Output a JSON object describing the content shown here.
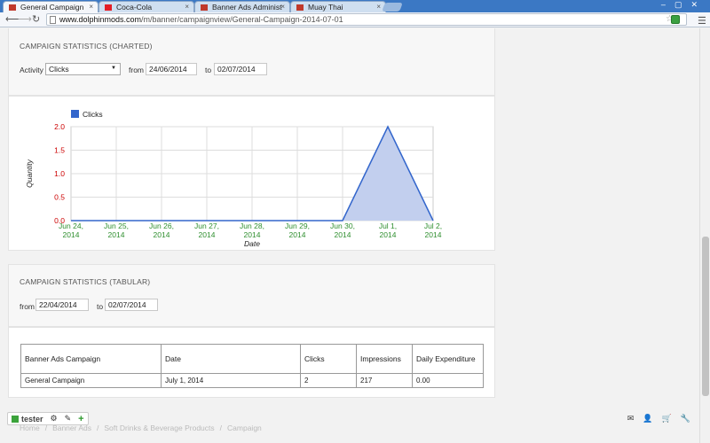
{
  "browser": {
    "tabs": [
      {
        "label": "General Campaign",
        "active": true,
        "favicon": "banner-favicon",
        "color": "#c0392b"
      },
      {
        "label": "Coca-Cola",
        "active": false,
        "favicon": "coke-favicon",
        "color": "#e41e26"
      },
      {
        "label": "Banner Ads Administ",
        "active": false,
        "favicon": "banner-favicon",
        "color": "#c0392b"
      },
      {
        "label": "Muay Thai",
        "active": false,
        "favicon": "banner-favicon",
        "color": "#c0392b"
      }
    ],
    "close_glyph": "×",
    "url_host": "www.dolphinmods.com",
    "url_path": "/m/banner/campaignview/General-Campaign-2014-07-01"
  },
  "charted": {
    "title": "CAMPAIGN STATISTICS (CHARTED)",
    "activity_label": "Activity",
    "activity_value": "Clicks",
    "from_label": "from",
    "from_value": "24/06/2014",
    "to_label": "to",
    "to_value": "02/07/2014"
  },
  "chart_data": {
    "type": "area",
    "categories": [
      "Jun 24, 2014",
      "Jun 25, 2014",
      "Jun 26, 2014",
      "Jun 27, 2014",
      "Jun 28, 2014",
      "Jun 29, 2014",
      "Jun 30, 2014",
      "Jul 1, 2014",
      "Jul 2, 2014"
    ],
    "series": [
      {
        "name": "Clicks",
        "values": [
          0,
          0,
          0,
          0,
          0,
          0,
          0,
          2,
          0
        ]
      }
    ],
    "xlabel": "Date",
    "ylabel": "Quantity",
    "yticks": [
      "0.0",
      "0.5",
      "1.0",
      "1.5",
      "2.0"
    ],
    "ylim": [
      0,
      2
    ],
    "grid": true,
    "legend": "top-left",
    "colors": {
      "series": "#3366cc",
      "fill": "#c2cfee",
      "ytick": "#cc0000",
      "xtick": "#2f8f2f"
    }
  },
  "tabular": {
    "title": "CAMPAIGN STATISTICS (TABULAR)",
    "from_label": "from",
    "from_value": "22/04/2014",
    "to_label": "to",
    "to_value": "02/07/2014",
    "columns": [
      "Banner Ads Campaign",
      "Date",
      "Clicks",
      "Impressions",
      "Daily Expenditure"
    ],
    "rows": [
      [
        "General Campaign",
        "July 1, 2014",
        "2",
        "217",
        "0.00"
      ]
    ]
  },
  "footer": {
    "user": "tester",
    "breadcrumbs": [
      "Home",
      "Banner Ads",
      "Soft Drinks & Beverage Products",
      "Campaign"
    ],
    "breadcrumb_sep": "/"
  }
}
